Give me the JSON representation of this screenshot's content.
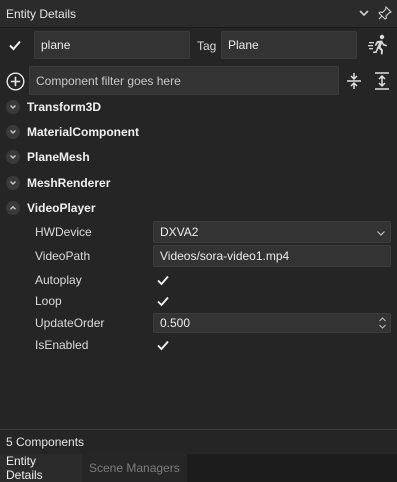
{
  "window": {
    "title": "Entity Details",
    "icons": [
      "chevron-down-icon",
      "pin-icon"
    ]
  },
  "entity": {
    "enabled": true,
    "name": "plane",
    "tag_label": "Tag",
    "tag_value": "Plane"
  },
  "filter": {
    "placeholder": "Component filter goes here"
  },
  "components": [
    {
      "name": "Transform3D",
      "expanded": false
    },
    {
      "name": "MaterialComponent",
      "expanded": false
    },
    {
      "name": "PlaneMesh",
      "expanded": false
    },
    {
      "name": "MeshRenderer",
      "expanded": false
    },
    {
      "name": "VideoPlayer",
      "expanded": true
    }
  ],
  "video_player": {
    "hwdevice_label": "HWDevice",
    "hwdevice_value": "DXVA2",
    "videopath_label": "VideoPath",
    "videopath_value": "Videos/sora-video1.mp4",
    "autoplay_label": "Autoplay",
    "autoplay_value": true,
    "loop_label": "Loop",
    "loop_value": true,
    "updateorder_label": "UpdateOrder",
    "updateorder_value": "0.500",
    "isenabled_label": "IsEnabled",
    "isenabled_value": true
  },
  "footer": {
    "count": "5 Components"
  },
  "tabs": [
    {
      "label": "Entity Details",
      "active": true
    },
    {
      "label": "Scene Managers",
      "active": false
    }
  ],
  "colors": {
    "panel_bg": "#252525",
    "field_bg": "#333333",
    "text": "#e4e4e4"
  }
}
